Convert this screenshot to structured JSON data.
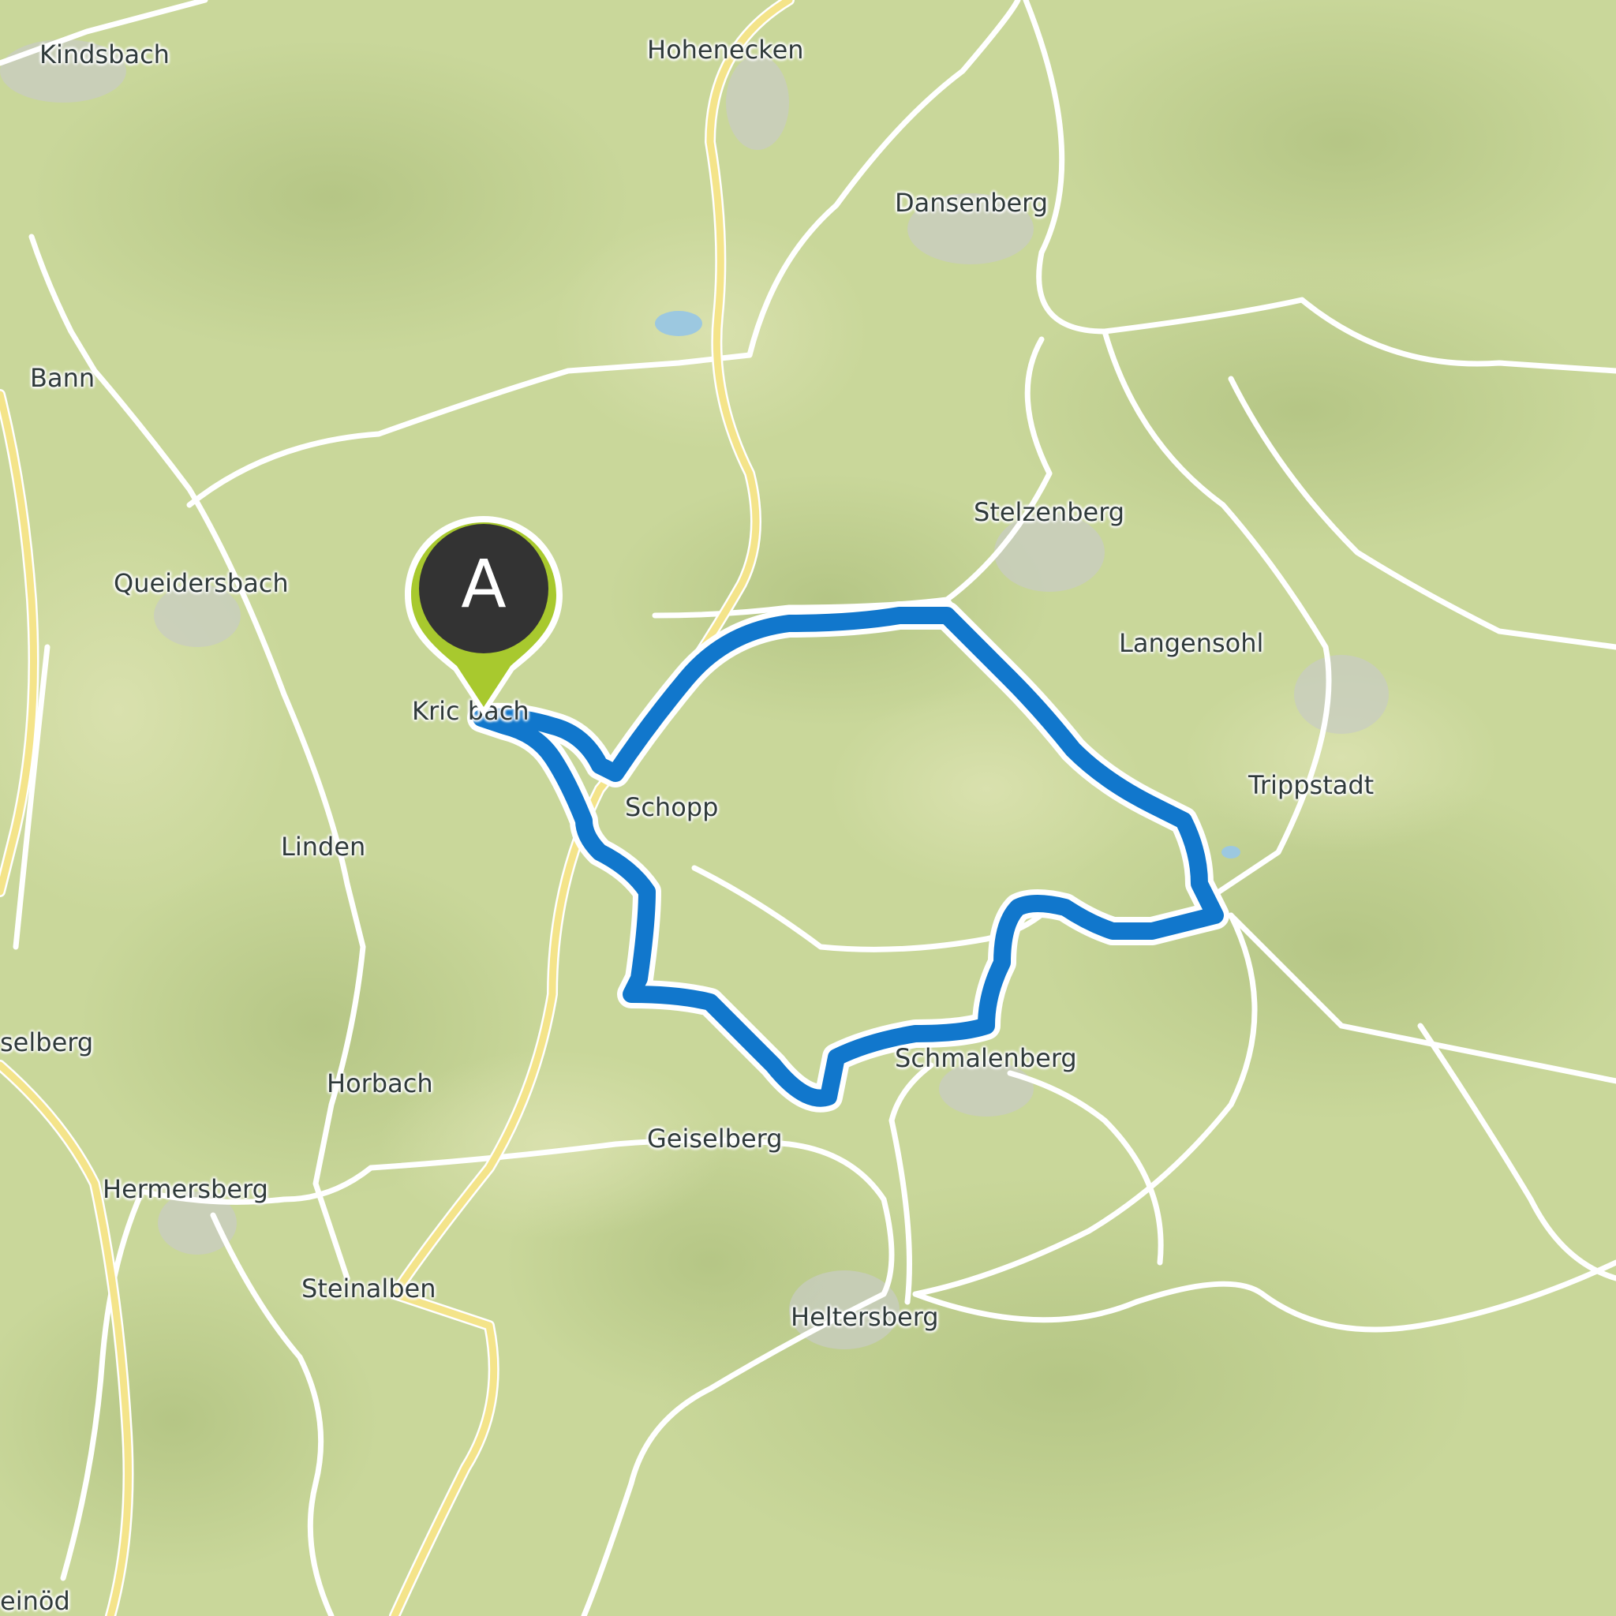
{
  "map": {
    "places": [
      {
        "id": "kindsbach",
        "name": "Kindsbach"
      },
      {
        "id": "hohenecken",
        "name": "Hohenecken"
      },
      {
        "id": "dansenberg",
        "name": "Dansenberg"
      },
      {
        "id": "bann",
        "name": "Bann"
      },
      {
        "id": "stelzenberg",
        "name": "Stelzenberg"
      },
      {
        "id": "queidersbach",
        "name": "Queidersbach"
      },
      {
        "id": "langensohl",
        "name": "Langensohl"
      },
      {
        "id": "krickenbach",
        "name": "Kric  bach"
      },
      {
        "id": "trippstadt",
        "name": "Trippstadt"
      },
      {
        "id": "schopp",
        "name": "Schopp"
      },
      {
        "id": "linden",
        "name": "Linden"
      },
      {
        "id": "geiselberg-west",
        "name": "selberg"
      },
      {
        "id": "schmalenberg",
        "name": "Schmalenberg"
      },
      {
        "id": "horbach",
        "name": "Horbach"
      },
      {
        "id": "geiselberg",
        "name": "Geiselberg"
      },
      {
        "id": "hermersberg",
        "name": "Hermersberg"
      },
      {
        "id": "steinalben",
        "name": "Steinalben"
      },
      {
        "id": "heltersberg",
        "name": "Heltersberg"
      },
      {
        "id": "weiselberg-sw",
        "name": "einöd"
      }
    ],
    "marker": {
      "letter": "A",
      "color": "#a8c92e",
      "inner_color": "#333333"
    },
    "route": {
      "color": "#1177cc",
      "outline": "#ffffff"
    },
    "colors": {
      "land": "#c9d79a",
      "forest_dark": "#a9bd7c",
      "road": "#ffffff",
      "main_road": "#f4e48a",
      "water": "#9cc8e0"
    }
  }
}
